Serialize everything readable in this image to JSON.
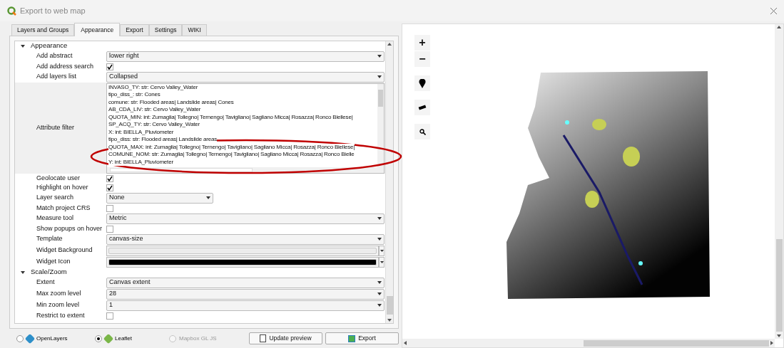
{
  "window": {
    "title": "Export to web map"
  },
  "tabs": [
    {
      "label": "Layers and Groups",
      "selected": false
    },
    {
      "label": "Appearance",
      "selected": true
    },
    {
      "label": "Export",
      "selected": false
    },
    {
      "label": "Settings",
      "selected": false
    },
    {
      "label": "WIKI",
      "selected": false
    }
  ],
  "sections": [
    {
      "title": "Appearance",
      "expanded": true,
      "rows": [
        {
          "kind": "combo",
          "label": "Add abstract",
          "value": "lower right"
        },
        {
          "kind": "checkbox",
          "label": "Add address search",
          "checked": true
        },
        {
          "kind": "combo",
          "label": "Add layers list",
          "value": "Collapsed"
        },
        {
          "kind": "list",
          "label": "Attribute filter",
          "items": [
            "INVASO_TY: str: Cervo Valley_Water",
            "tipo_diss_: str: Cones",
            "comune: str: Flooded areas| Landslide areas| Cones",
            "AB_CDA_LIV: str: Cervo Valley_Water",
            "QUOTA_MIN: int: Zumaglia| Tollegno| Ternengo| Tavigliano| Sagliano Micca| Rosazza| Ronco Biellese|",
            "SP_ACQ_TY: str: Cervo Valley_Water",
            "X: int: BIELLA_Pluviometer",
            "tipo_diss: str: Flooded areas| Landslide areas",
            "QUOTA_MAX: int: Zumaglia| Tollegno| Ternengo| Tavigliano| Sagliano Micca| Rosazza| Ronco Biellese|",
            "COMUNE_NOM: str: Zumaglia| Tollegno| Ternengo| Tavigliano| Sagliano Micca| Rosazza| Ronco Bielle",
            "Y: int: BIELLA_Pluviometer"
          ]
        },
        {
          "kind": "checkbox",
          "label": "Geolocate user",
          "checked": true
        },
        {
          "kind": "checkbox",
          "label": "Highlight on hover",
          "checked": true
        },
        {
          "kind": "shortcombo",
          "label": "Layer search",
          "value": "None"
        },
        {
          "kind": "checkbox",
          "label": "Match project CRS",
          "checked": false
        },
        {
          "kind": "combo",
          "label": "Measure tool",
          "value": "Metric"
        },
        {
          "kind": "checkbox",
          "label": "Show popups on hover",
          "checked": false
        },
        {
          "kind": "combo",
          "label": "Template",
          "value": "canvas-size"
        },
        {
          "kind": "color",
          "label": "Widget Background",
          "color": "#ececec"
        },
        {
          "kind": "color",
          "label": "Widget Icon",
          "color": "#000000"
        }
      ]
    },
    {
      "title": "Scale/Zoom",
      "expanded": true,
      "rows": [
        {
          "kind": "combo",
          "label": "Extent",
          "value": "Canvas extent"
        },
        {
          "kind": "combo",
          "label": "Max zoom level",
          "value": "28"
        },
        {
          "kind": "combo",
          "label": "Min zoom level",
          "value": "1"
        },
        {
          "kind": "checkbox",
          "label": "Restrict to extent",
          "checked": false
        }
      ]
    }
  ],
  "libraries": [
    {
      "label": "OpenLayers",
      "selected": false,
      "disabled": false
    },
    {
      "label": "Leaflet",
      "selected": true,
      "disabled": false
    },
    {
      "label": "Mapbox GL JS",
      "selected": false,
      "disabled": true
    }
  ],
  "buttons": [
    {
      "kind": "preview",
      "label": "Update preview"
    },
    {
      "kind": "export",
      "label": "Export"
    }
  ],
  "map_controls": [
    {
      "kind": "zoom-in",
      "label": "+"
    },
    {
      "kind": "zoom-out",
      "label": "−"
    },
    {
      "kind": "locate"
    },
    {
      "kind": "measure"
    },
    {
      "kind": "search"
    }
  ]
}
